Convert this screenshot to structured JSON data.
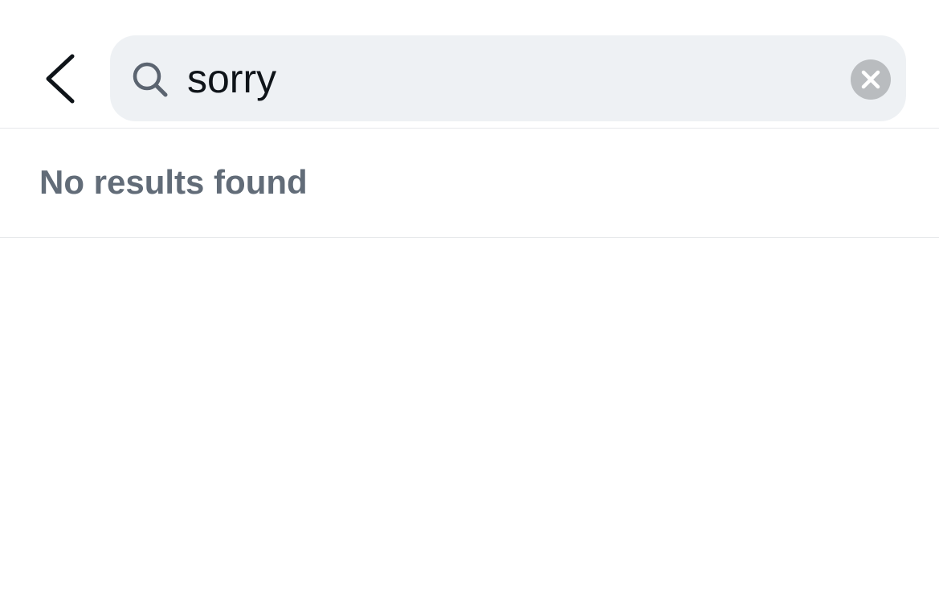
{
  "header": {
    "back_icon": "chevron-left-icon",
    "search": {
      "icon": "search-icon",
      "value": "sorry",
      "clear_icon": "close-icon"
    }
  },
  "results": {
    "message": "No results found"
  },
  "colors": {
    "search_background": "#eef1f4",
    "text_primary": "#0f1419",
    "text_secondary": "#626c78",
    "clear_button": "#b9bcbf",
    "divider": "#e6e8eb"
  }
}
